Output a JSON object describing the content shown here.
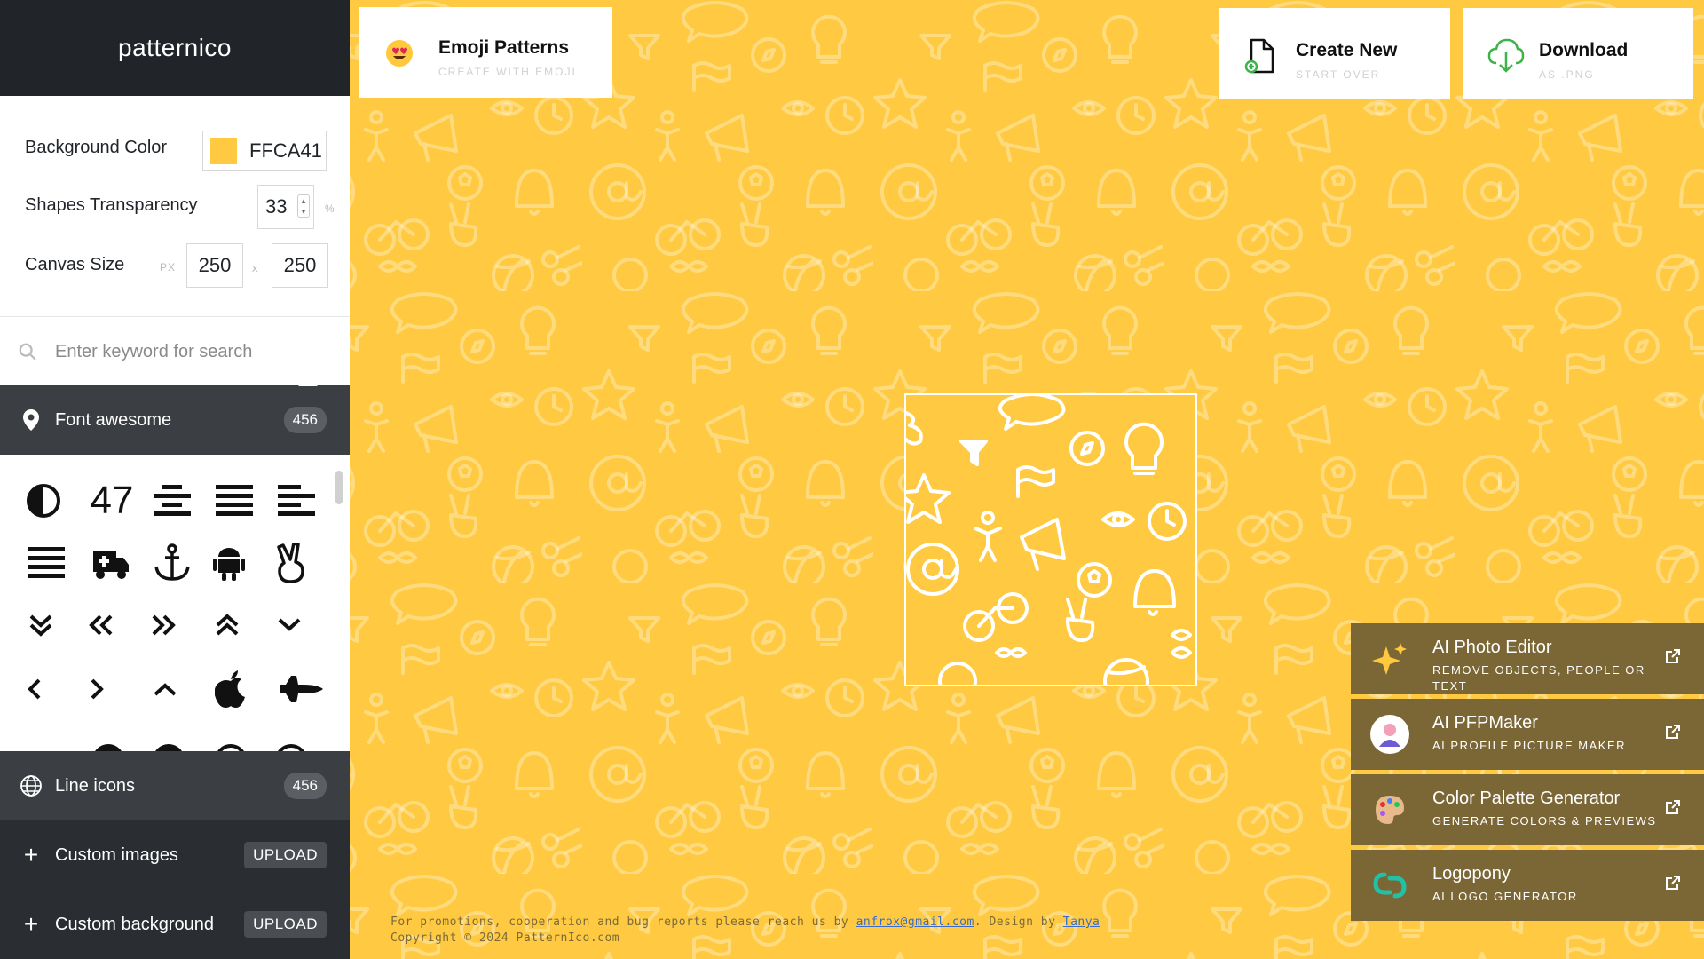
{
  "app": {
    "title": "patternico"
  },
  "settings": {
    "bg_color_label": "Background Color",
    "bg_color_value": "FFCA41",
    "bg_color_hex": "#FFCA41",
    "transparency_label": "Shapes Transparency",
    "transparency_value": "33",
    "transparency_unit": "%",
    "canvas_label": "Canvas Size",
    "canvas_unit": "PX",
    "canvas_width": "250",
    "canvas_sep": "x",
    "canvas_height": "250"
  },
  "search": {
    "placeholder": "Enter keyword for search"
  },
  "sections": {
    "font_awesome": {
      "label": "Font awesome",
      "count": "456"
    },
    "line_icons": {
      "label": "Line icons",
      "count": "456"
    },
    "custom_images": {
      "label": "Custom images",
      "action": "UPLOAD"
    },
    "custom_background": {
      "label": "Custom background",
      "action": "UPLOAD"
    }
  },
  "icon_grid": {
    "icons": [
      "adjust-icon",
      "number-47-icon",
      "align-center-icon",
      "align-justify-icon",
      "align-left-icon",
      "list-icon",
      "ambulance-icon",
      "anchor-icon",
      "android-icon",
      "victory-hand-icon",
      "angle-double-down-icon",
      "angle-double-left-icon",
      "angle-double-right-icon",
      "angle-double-up-icon",
      "angle-down-icon",
      "angle-left-icon",
      "angle-right-icon",
      "angle-up-icon",
      "apple-icon",
      "space-shuttle-icon"
    ],
    "number_label": "47"
  },
  "top": {
    "emoji": {
      "title": "Emoji Patterns",
      "subtitle": "CREATE WITH EMOJI"
    },
    "create": {
      "title": "Create New",
      "subtitle": "START OVER"
    },
    "download": {
      "title": "Download",
      "subtitle": "AS .PNG"
    }
  },
  "promos": [
    {
      "title": "AI Photo Editor",
      "subtitle": "REMOVE OBJECTS, PEOPLE OR TEXT",
      "icon": "sparkles-icon"
    },
    {
      "title": "AI PFPMaker",
      "subtitle": "AI PROFILE PICTURE MAKER",
      "icon": "avatar-icon"
    },
    {
      "title": "Color Palette Generator",
      "subtitle": "GENERATE COLORS & PREVIEWS",
      "icon": "palette-icon"
    },
    {
      "title": "Logopony",
      "subtitle": "AI LOGO GENERATOR",
      "icon": "logopony-icon"
    }
  ],
  "footer": {
    "line1_a": "For promotions, cooperation and bug reports please reach us by ",
    "email": "anfrox@gmail.com",
    "line1_b": ". Design by ",
    "designer": "Tanya",
    "line2": "Copyright © 2024 PatternIco.com"
  },
  "colors": {
    "background": "#FFCA41",
    "sidebar_dark": "#212529",
    "section": "#3b3e42",
    "promo": "#7b6636"
  }
}
